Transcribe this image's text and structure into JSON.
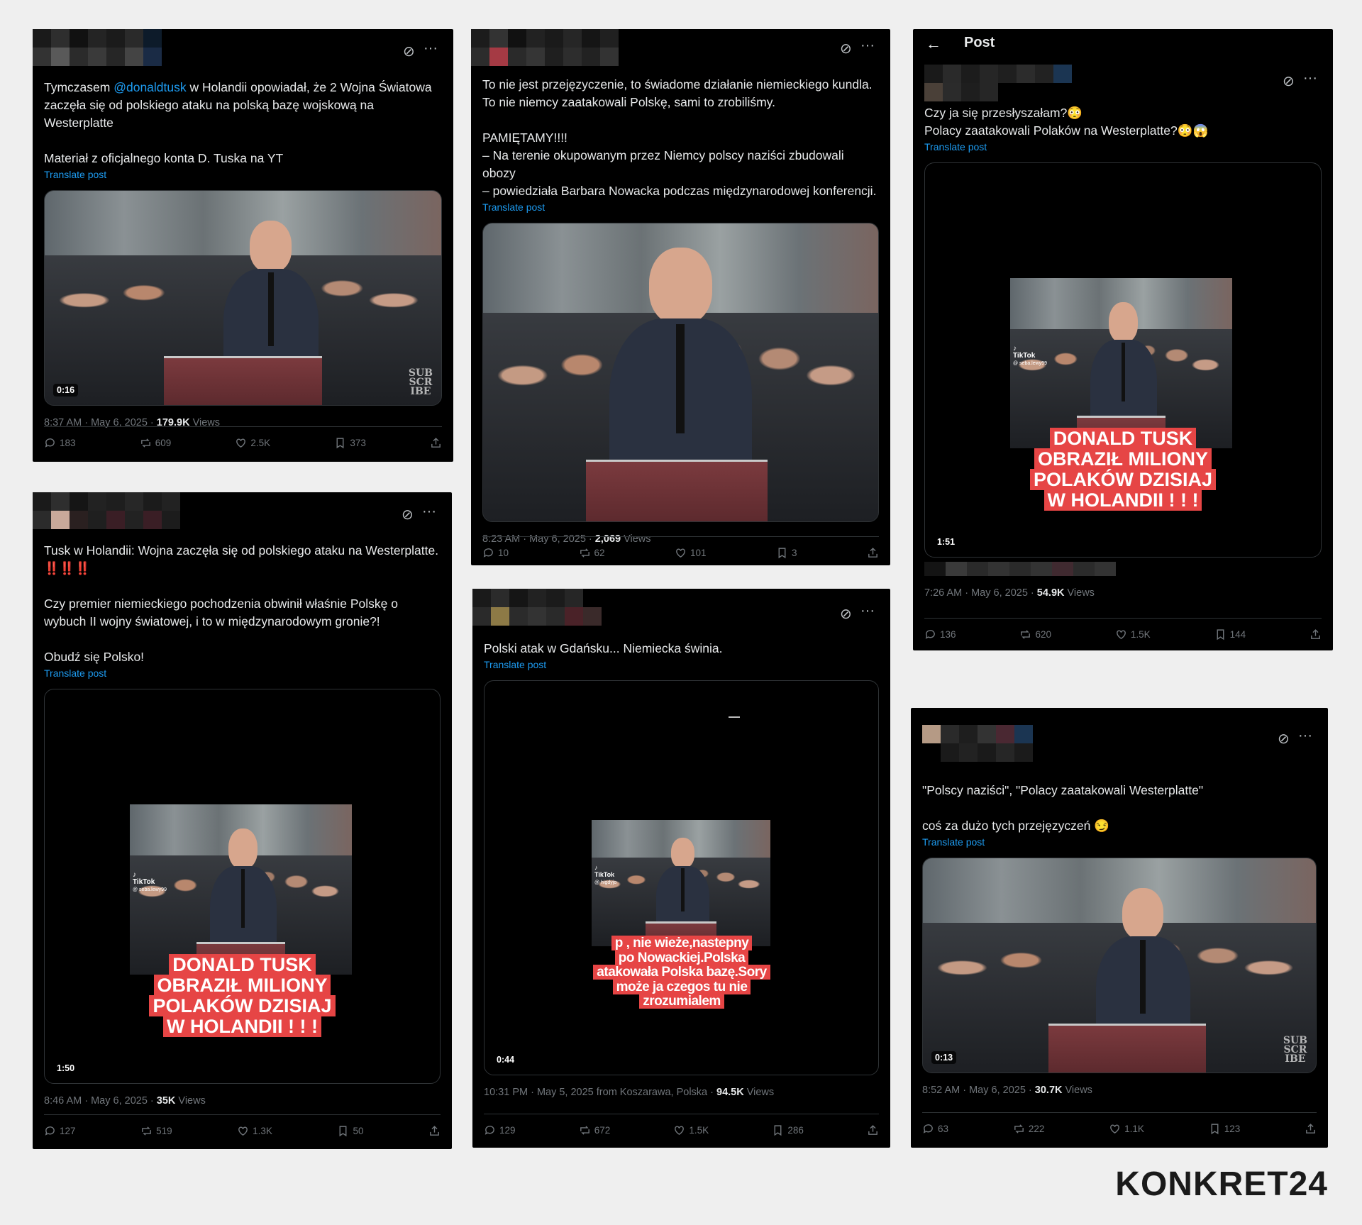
{
  "logo": "KONKRET24",
  "common": {
    "translate": "Translate post",
    "views": "Views"
  },
  "posts": [
    {
      "id": "p1",
      "text_before": "Tymczasem ",
      "mention": "@donaldtusk",
      "text_after": " w Holandii opowiadał, że 2 Wojna Światowa zaczęła się od polskiego ataku na polską bazę wojskową na Westerplatte\n\nMateriał z oficjalnego konta D. Tuska na YT",
      "duration": "0:16",
      "watermark": "SUB\nSCR\nIBE",
      "meta_time": "8:37 AM · May 6, 2025 · ",
      "meta_views": "179.9K",
      "stats": {
        "replies": "183",
        "reposts": "609",
        "likes": "2.5K",
        "bookmarks": "373"
      }
    },
    {
      "id": "p2",
      "text": "To nie jest przejęzyczenie, to świadome działanie niemieckiego kundla. To nie niemcy zaatakowali Polskę, sami to zrobiliśmy.\n\nPAMIĘTAMY!!!!\n – Na terenie okupowanym przez Niemcy polscy naziści zbudowali obozy\n–  powiedziała Barbara Nowacka podczas międzynarodowej konferencji.",
      "meta_time": "8:23 AM · May 6, 2025 · ",
      "meta_views": "2,069",
      "stats": {
        "replies": "10",
        "reposts": "62",
        "likes": "101",
        "bookmarks": "3"
      }
    },
    {
      "id": "p3",
      "header_title": "Post",
      "text": "Czy ja się przesłyszałam?😳\nPolacy zaatakowali Polaków na Westerplatte?😳😱",
      "caption": [
        "DONALD TUSK",
        "OBRAZIŁ MILIONY",
        "POLAKÓW DZISIAJ",
        "W HOLANDII ! ! !"
      ],
      "tiktok": "TikTok",
      "tiktok_user": "@ seba.lewy99",
      "duration": "1:51",
      "meta_time": "7:26 AM · May 6, 2025 · ",
      "meta_views": "54.9K",
      "stats": {
        "replies": "136",
        "reposts": "620",
        "likes": "1.5K",
        "bookmarks": "144"
      }
    },
    {
      "id": "p4",
      "text": "Tusk w Holandii: Wojna zaczęła się od polskiego ataku na Westerplatte.\n‼️‼️‼️\n\nCzy premier niemieckiego pochodzenia obwinił właśnie Polskę o wybuch II wojny światowej, i to w międzynarodowym gronie?!\n\nObudź się Polsko!",
      "caption": [
        "DONALD TUSK",
        "OBRAZIŁ MILIONY",
        "POLAKÓW DZISIAJ",
        "W HOLANDII ! ! !"
      ],
      "tiktok": "TikTok",
      "tiktok_user": "@ seba.lewy99",
      "duration": "1:50",
      "meta_time": "8:46 AM · May 6, 2025 · ",
      "meta_views": "35K",
      "stats": {
        "replies": "127",
        "reposts": "519",
        "likes": "1.3K",
        "bookmarks": "50"
      }
    },
    {
      "id": "p5",
      "text": "Polski atak w Gdańsku... Niemiecka świnia.",
      "caption": [
        "p        , nie wieże,nastepny",
        "po Nowackiej.Polska",
        "atakowała Polska bazę.Sory",
        "może ja czegos tu nie",
        "zrozumialem"
      ],
      "tiktok": "TikTok",
      "tiktok_user": "@ higdyjo",
      "duration": "0:44",
      "meta_time": "10:31 PM · May 5, 2025 from Koszarawa, Polska · ",
      "meta_views": "94.5K",
      "stats": {
        "replies": "129",
        "reposts": "672",
        "likes": "1.5K",
        "bookmarks": "286"
      }
    },
    {
      "id": "p6",
      "text": "\"Polscy naziści\", \"Polacy zaatakowali Westerplatte\"\n\ncoś za dużo tych przejęzyczeń 😏",
      "duration": "0:13",
      "watermark": "SUB\nSCR\nIBE",
      "meta_time": "8:52 AM · May 6, 2025 · ",
      "meta_views": "30.7K",
      "stats": {
        "replies": "63",
        "reposts": "222",
        "likes": "1.1K",
        "bookmarks": "123"
      }
    }
  ]
}
